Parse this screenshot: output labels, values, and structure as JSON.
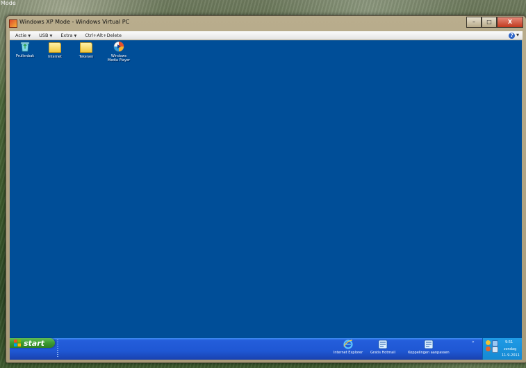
{
  "host": {
    "corner_label": "Mode"
  },
  "window": {
    "title": "Windows XP Mode - Windows Virtual PC",
    "controls": {
      "minimize": "–",
      "maximize": "□",
      "close": "X"
    }
  },
  "menubar": {
    "items": [
      {
        "label": "Actie",
        "has_dropdown": true
      },
      {
        "label": "USB",
        "has_dropdown": true
      },
      {
        "label": "Extra",
        "has_dropdown": true
      },
      {
        "label": "Ctrl+Alt+Delete",
        "has_dropdown": false
      }
    ],
    "dropdown_caret": "▼",
    "help_glyph": "?"
  },
  "desktop": {
    "background_color": "#004e98",
    "icons": [
      {
        "label": "Prullenbak",
        "icon": "recycle-bin-icon"
      },
      {
        "label": "Internet",
        "icon": "folder-icon"
      },
      {
        "label": "Tekenen",
        "icon": "folder-icon"
      },
      {
        "label_line1": "Windows",
        "label_line2": "Media Player",
        "icon": "media-player-icon"
      }
    ]
  },
  "taskbar": {
    "start_label": "start",
    "quick_launch": [
      {
        "label": "Internet Explorer",
        "icon": "internet-explorer-icon"
      },
      {
        "label": "Gratis Hotmail",
        "icon": "hotmail-icon"
      },
      {
        "label": "Koppelingen aanpassen",
        "icon": "customize-links-icon"
      }
    ],
    "expand_glyph": "»",
    "tray": {
      "time": "9:51",
      "day": "zondag",
      "date": "11-9-2011"
    }
  }
}
